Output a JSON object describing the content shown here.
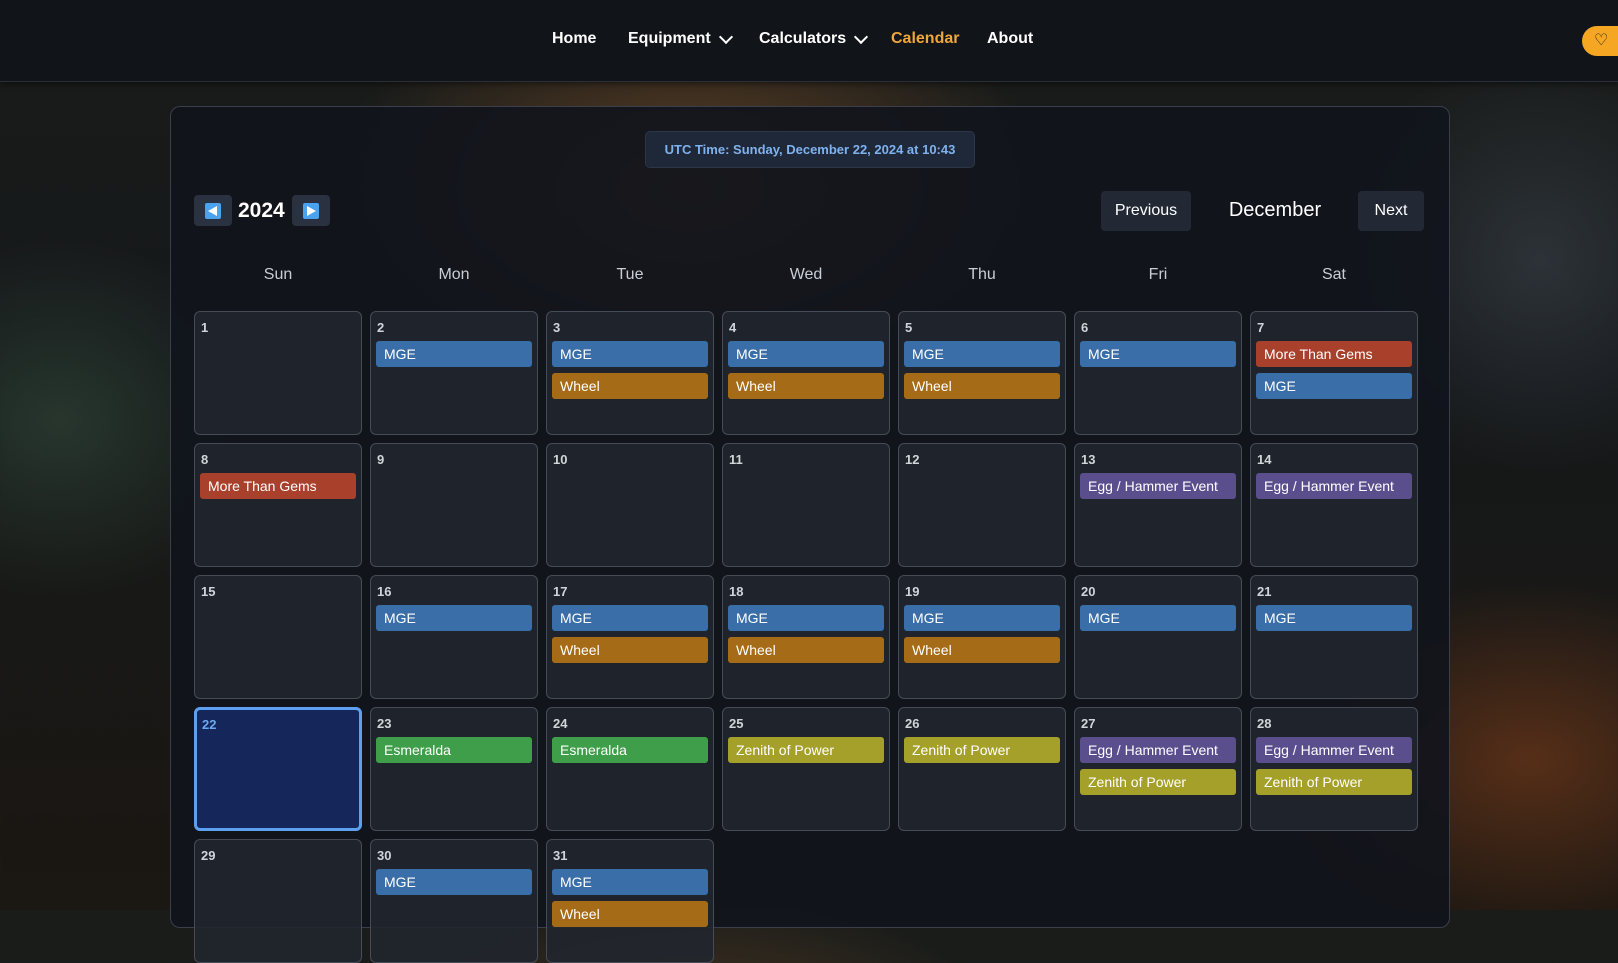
{
  "nav": {
    "items": [
      {
        "label": "Home",
        "active": false,
        "dropdown": false
      },
      {
        "label": "Equipment",
        "active": false,
        "dropdown": true
      },
      {
        "label": "Calculators",
        "active": false,
        "dropdown": true
      },
      {
        "label": "Calendar",
        "active": true,
        "dropdown": false
      },
      {
        "label": "About",
        "active": false,
        "dropdown": false
      }
    ],
    "support_icon": "heart-icon"
  },
  "utc_time": "UTC Time: Sunday, December 22, 2024 at 10:43",
  "year": "2024",
  "month": "December",
  "prev_label": "Previous",
  "next_label": "Next",
  "weekdays": [
    "Sun",
    "Mon",
    "Tue",
    "Wed",
    "Thu",
    "Fri",
    "Sat"
  ],
  "colors": {
    "MGE": "#3a6ea8",
    "Wheel": "#a66b16",
    "More Than Gems": "#a8402c",
    "Egg / Hammer Event": "#5a4f8c",
    "Esmeralda": "#3f9e4a",
    "Zenith of Power": "#a5a02a"
  },
  "today": 22,
  "days": [
    {
      "num": "1",
      "events": []
    },
    {
      "num": "2",
      "events": [
        "MGE"
      ]
    },
    {
      "num": "3",
      "events": [
        "MGE",
        "Wheel"
      ]
    },
    {
      "num": "4",
      "events": [
        "MGE",
        "Wheel"
      ]
    },
    {
      "num": "5",
      "events": [
        "MGE",
        "Wheel"
      ]
    },
    {
      "num": "6",
      "events": [
        "MGE"
      ]
    },
    {
      "num": "7",
      "events": [
        "More Than Gems",
        "MGE"
      ]
    },
    {
      "num": "8",
      "events": [
        "More Than Gems"
      ]
    },
    {
      "num": "9",
      "events": []
    },
    {
      "num": "10",
      "events": []
    },
    {
      "num": "11",
      "events": []
    },
    {
      "num": "12",
      "events": []
    },
    {
      "num": "13",
      "events": [
        "Egg / Hammer Event"
      ]
    },
    {
      "num": "14",
      "events": [
        "Egg / Hammer Event"
      ]
    },
    {
      "num": "15",
      "events": []
    },
    {
      "num": "16",
      "events": [
        "MGE"
      ]
    },
    {
      "num": "17",
      "events": [
        "MGE",
        "Wheel"
      ]
    },
    {
      "num": "18",
      "events": [
        "MGE",
        "Wheel"
      ]
    },
    {
      "num": "19",
      "events": [
        "MGE",
        "Wheel"
      ]
    },
    {
      "num": "20",
      "events": [
        "MGE"
      ]
    },
    {
      "num": "21",
      "events": [
        "MGE"
      ]
    },
    {
      "num": "22",
      "events": []
    },
    {
      "num": "23",
      "events": [
        "Esmeralda"
      ]
    },
    {
      "num": "24",
      "events": [
        "Esmeralda"
      ]
    },
    {
      "num": "25",
      "events": [
        "Zenith of Power"
      ]
    },
    {
      "num": "26",
      "events": [
        "Zenith of Power"
      ]
    },
    {
      "num": "27",
      "events": [
        "Egg / Hammer Event",
        "Zenith of Power"
      ]
    },
    {
      "num": "28",
      "events": [
        "Egg / Hammer Event",
        "Zenith of Power"
      ]
    },
    {
      "num": "29",
      "events": []
    },
    {
      "num": "30",
      "events": [
        "MGE"
      ]
    },
    {
      "num": "31",
      "events": [
        "MGE",
        "Wheel"
      ]
    }
  ]
}
